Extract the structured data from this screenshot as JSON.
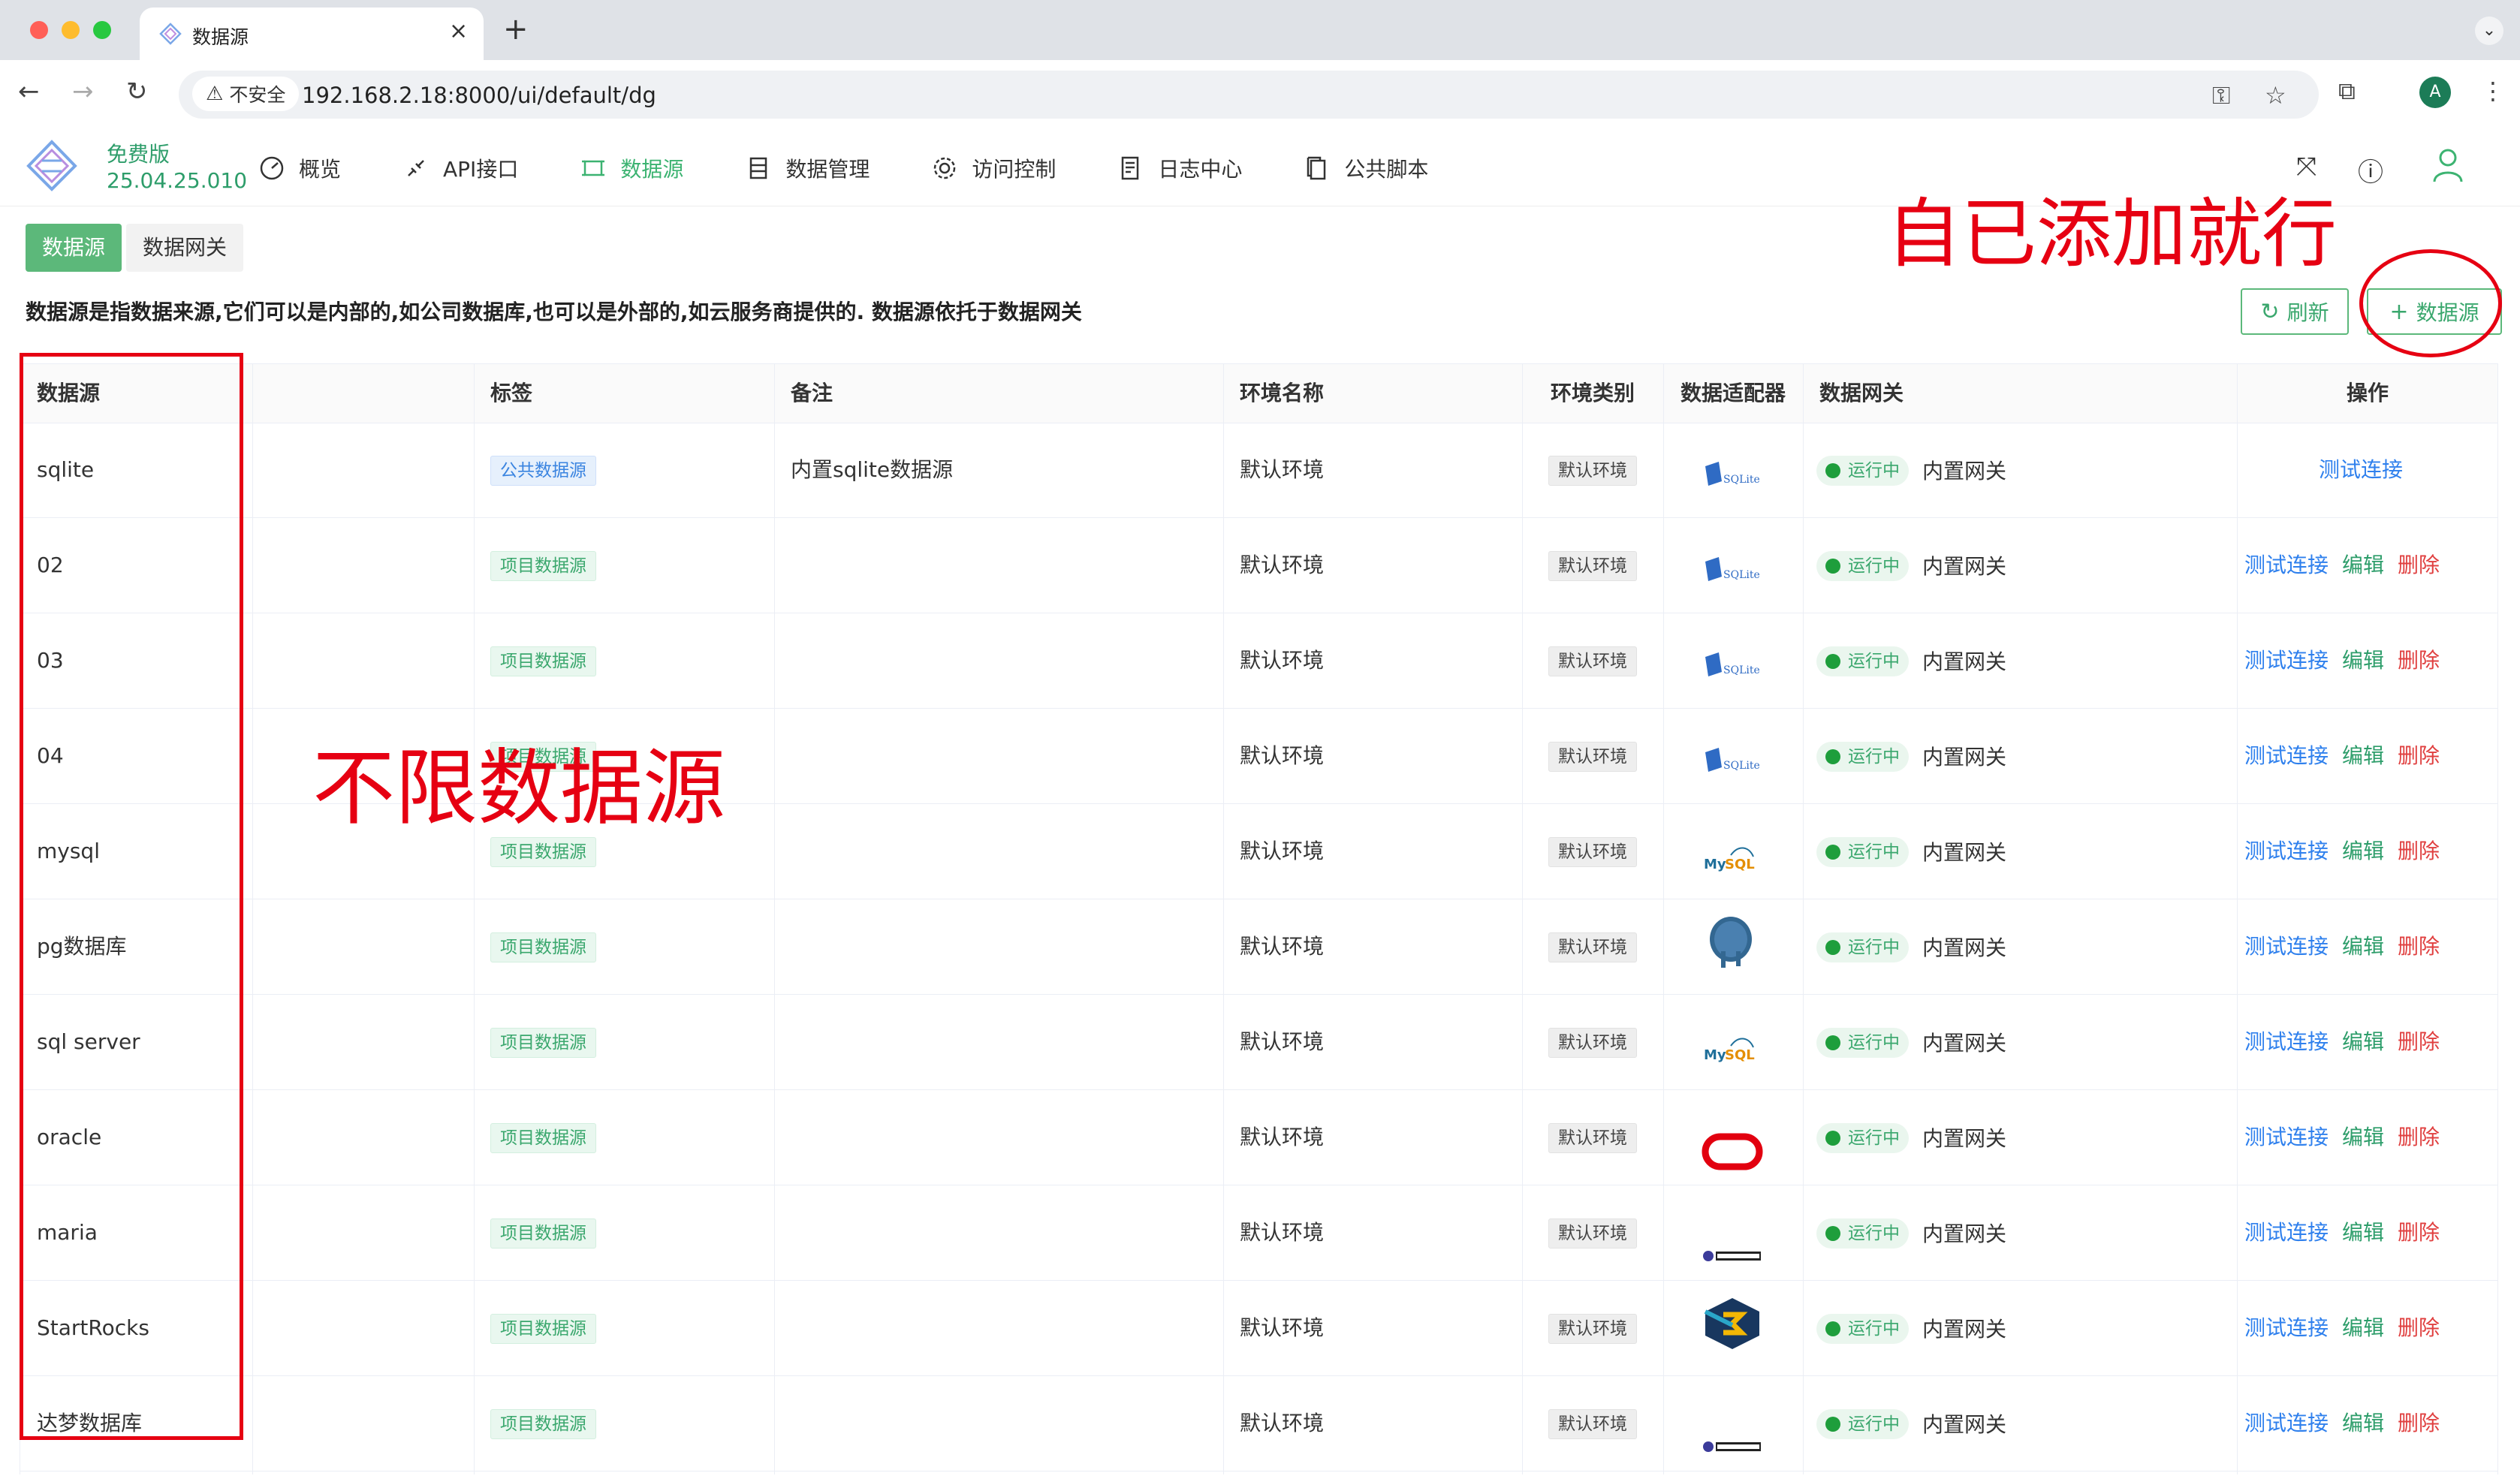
{
  "browser": {
    "tab_title": "数据源",
    "tab_close": "×",
    "tab_new": "+",
    "tab_menu": "⌄",
    "security_label": "不安全",
    "url": "192.168.2.18:8000/ui/default/dg",
    "profile_initial": "A"
  },
  "app": {
    "edition": "免费版",
    "version": "25.04.25.010",
    "menu": [
      {
        "label": "概览",
        "icon": "dashboard-icon"
      },
      {
        "label": "API接口",
        "icon": "api-icon"
      },
      {
        "label": "数据源",
        "icon": "datasource-icon",
        "active": true
      },
      {
        "label": "数据管理",
        "icon": "database-icon"
      },
      {
        "label": "访问控制",
        "icon": "gear-icon"
      },
      {
        "label": "日志中心",
        "icon": "log-icon"
      },
      {
        "label": "公共脚本",
        "icon": "script-icon"
      }
    ],
    "accent": "#3cb371"
  },
  "subtabs": [
    "数据源",
    "数据网关"
  ],
  "description": "数据源是指数据来源,它们可以是内部的,如公司数据库,也可以是外部的,如云服务商提供的. 数据源依托于数据网关",
  "buttons": {
    "refresh": "刷新",
    "add": "数据源"
  },
  "table": {
    "headers": [
      "数据源",
      "标签",
      "备注",
      "环境名称",
      "环境类别",
      "数据适配器",
      "数据网关",
      "操作"
    ],
    "rows": [
      {
        "name": "sqlite",
        "tag": "公共数据源",
        "tag_type": "public",
        "remark": "内置sqlite数据源",
        "env_name": "默认环境",
        "env_type": "默认环境",
        "adapter": "sqlite",
        "status": "运行中",
        "gateway": "内置网关",
        "actions": [
          "测试连接"
        ]
      },
      {
        "name": "02",
        "tag": "项目数据源",
        "tag_type": "project",
        "remark": "",
        "env_name": "默认环境",
        "env_type": "默认环境",
        "adapter": "sqlite",
        "status": "运行中",
        "gateway": "内置网关",
        "actions": [
          "测试连接",
          "编辑",
          "删除"
        ]
      },
      {
        "name": "03",
        "tag": "项目数据源",
        "tag_type": "project",
        "remark": "",
        "env_name": "默认环境",
        "env_type": "默认环境",
        "adapter": "sqlite",
        "status": "运行中",
        "gateway": "内置网关",
        "actions": [
          "测试连接",
          "编辑",
          "删除"
        ]
      },
      {
        "name": "04",
        "tag": "项目数据源",
        "tag_type": "project",
        "remark": "",
        "env_name": "默认环境",
        "env_type": "默认环境",
        "adapter": "sqlite",
        "status": "运行中",
        "gateway": "内置网关",
        "actions": [
          "测试连接",
          "编辑",
          "删除"
        ]
      },
      {
        "name": "mysql",
        "tag": "项目数据源",
        "tag_type": "project",
        "remark": "",
        "env_name": "默认环境",
        "env_type": "默认环境",
        "adapter": "mysql",
        "status": "运行中",
        "gateway": "内置网关",
        "actions": [
          "测试连接",
          "编辑",
          "删除"
        ]
      },
      {
        "name": "pg数据库",
        "tag": "项目数据源",
        "tag_type": "project",
        "remark": "",
        "env_name": "默认环境",
        "env_type": "默认环境",
        "adapter": "postgresql",
        "status": "运行中",
        "gateway": "内置网关",
        "actions": [
          "测试连接",
          "编辑",
          "删除"
        ]
      },
      {
        "name": "sql server",
        "tag": "项目数据源",
        "tag_type": "project",
        "remark": "",
        "env_name": "默认环境",
        "env_type": "默认环境",
        "adapter": "mysql",
        "status": "运行中",
        "gateway": "内置网关",
        "actions": [
          "测试连接",
          "编辑",
          "删除"
        ]
      },
      {
        "name": "oracle",
        "tag": "项目数据源",
        "tag_type": "project",
        "remark": "",
        "env_name": "默认环境",
        "env_type": "默认环境",
        "adapter": "oracle",
        "status": "运行中",
        "gateway": "内置网关",
        "actions": [
          "测试连接",
          "编辑",
          "删除"
        ]
      },
      {
        "name": "maria",
        "tag": "项目数据源",
        "tag_type": "project",
        "remark": "",
        "env_name": "默认环境",
        "env_type": "默认环境",
        "adapter": "dameng",
        "status": "运行中",
        "gateway": "内置网关",
        "actions": [
          "测试连接",
          "编辑",
          "删除"
        ]
      },
      {
        "name": "StartRocks",
        "tag": "项目数据源",
        "tag_type": "project",
        "remark": "",
        "env_name": "默认环境",
        "env_type": "默认环境",
        "adapter": "starrocks",
        "status": "运行中",
        "gateway": "内置网关",
        "actions": [
          "测试连接",
          "编辑",
          "删除"
        ]
      },
      {
        "name": "达梦数据库",
        "tag": "项目数据源",
        "tag_type": "project",
        "remark": "",
        "env_name": "默认环境",
        "env_type": "默认环境",
        "adapter": "dameng",
        "status": "运行中",
        "gateway": "内置网关",
        "actions": [
          "测试连接",
          "编辑",
          "删除"
        ]
      }
    ]
  },
  "annotations": {
    "add_hint": "自已添加就行",
    "unlimited_hint": "不限数据源",
    "color": "#e60012"
  }
}
